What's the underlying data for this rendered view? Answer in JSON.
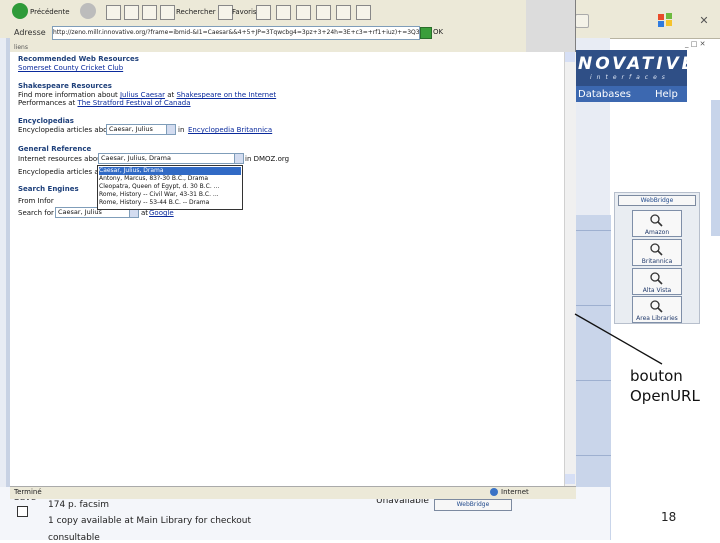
{
  "background_window": {
    "logo_text": "NOVATIVE",
    "logo_subtext": "interfaces",
    "nav_databases": "Databases",
    "nav_help": "Help",
    "webbridge_header": "WebBridge",
    "webbridge_buttons": [
      "Amazon",
      "Britannica",
      "Alta Vista",
      "Area Libraries"
    ],
    "bottom": {
      "save_label": "Save",
      "pfacsim": "174 p. facsim",
      "copy_text": "1 copy available at Main Library for checkout",
      "consult_text": "consultable",
      "unavailable": "Unavailable",
      "webbridge_button": "WebBridge"
    }
  },
  "popup": {
    "toolbar": {
      "back_label": "Précédente",
      "search_label": "Rechercher",
      "favorites_label": "Favoris"
    },
    "address_label": "Adresse",
    "address_url": "http://zeno.millr.innovative.org/?frame=ibmid-&I1=Caesar&&4+5+JP=3Tqwcbg4=3pz+3+24h=3E+c3=+rf1+iuz)+=3Q3",
    "go_label": "OK",
    "links_label": "liens",
    "sections": [
      {
        "title": "Recommended Web Resources",
        "line": "Somerset County Cricket Club"
      },
      {
        "title": "Shakespeare Resources",
        "line_parts": [
          "Find more information about ",
          "Julius Caesar",
          " at ",
          "Shakespeare on the Internet"
        ],
        "line2_parts": [
          "Performances at ",
          "The Stratford Festival of Canada"
        ]
      },
      {
        "title": "Encyclopedias",
        "line_prefix": "Encyclopedia articles about",
        "select_value": "Caesar, Julius",
        "line_suffix": "in",
        "link": "Encyclopedia Britannica"
      },
      {
        "title": "General Reference",
        "line_prefix": "Internet resources about",
        "select_value": "Caesar, Julius, Drama",
        "line_suffix": "in DMOZ.org",
        "line2_prefix": "Encyclopedia articles abo"
      },
      {
        "title": "Search Engines",
        "line_prefix": "From Infor",
        "line2_prefix": "Search for",
        "select_value": "Caesar, Julius",
        "line2_suffix": "at",
        "link": "Google"
      }
    ],
    "dropdown_items": [
      "Caesar, Julius, Drama",
      "Antony, Marcus, 83?-30 B.C., Drama",
      "Cleopatra, Queen of Egypt, d. 30 B.C. ...",
      "Rome, History -- Civil War, 43-31 B.C. ...",
      "Rome, History -- 53-44 B.C. -- Drama"
    ],
    "status_left": "Terminé",
    "status_right": "Internet"
  },
  "annotation": {
    "label_line1": "bouton",
    "label_line2": "OpenURL"
  },
  "page_number": "18",
  "colors": {
    "brand_dark": "#2f4f86",
    "brand_nav": "#3c68b0",
    "link": "#0a2a9c",
    "section_title": "#1d3f7a",
    "selection": "#316ac5"
  }
}
